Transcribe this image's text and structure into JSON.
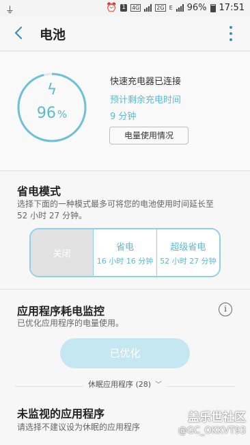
{
  "status_bar": {
    "left_icon": "usb-icon",
    "indicators": [
      "alarm-icon",
      "1",
      "4G",
      "2G",
      "E"
    ],
    "battery_percent": "96%",
    "time": "17:51"
  },
  "app_bar": {
    "title": "电池",
    "back_icon": "back-arrow-icon",
    "more_icon": "more-vertical-icon"
  },
  "battery": {
    "percent_value": "96",
    "percent_unit": "%",
    "level_fraction": 0.96,
    "charge_status": "快速充电器已连接",
    "remaining_label": "预计剩余充电时间",
    "remaining_value": "9 分钟",
    "usage_button": "电量使用情况",
    "accent_color": "#5bbad1"
  },
  "power_saving": {
    "title": "省电模式",
    "description": "选择下面的一种模式最多可将您的电池使用时间延长至 52 小时 27 分钟。",
    "description_line1": "选择下面的一种模式最多可将您的电池使用时间延长至",
    "description_line2": "52 小时 27 分钟。",
    "modes": [
      {
        "name": "关闭",
        "sub": ""
      },
      {
        "name": "省电",
        "sub": "16 小时 16 分钟"
      },
      {
        "name": "超级省电",
        "sub": "52 小时 27 分钟"
      }
    ],
    "selected_index": 0
  },
  "app_monitor": {
    "title": "应用程序耗电监控",
    "description": "已优化应用程序的电量使用。",
    "info_icon": "info-icon",
    "optimize_button": "已优化",
    "sleeping_apps": "休眠应用程序 (28)",
    "unmonitored_title": "未监视的应用程序",
    "unmonitored_desc": "请选择不建议设为休眠的应用程序"
  },
  "watermark": {
    "line1": "盖乐世社区",
    "line2": "@GC_OKKVT93"
  }
}
